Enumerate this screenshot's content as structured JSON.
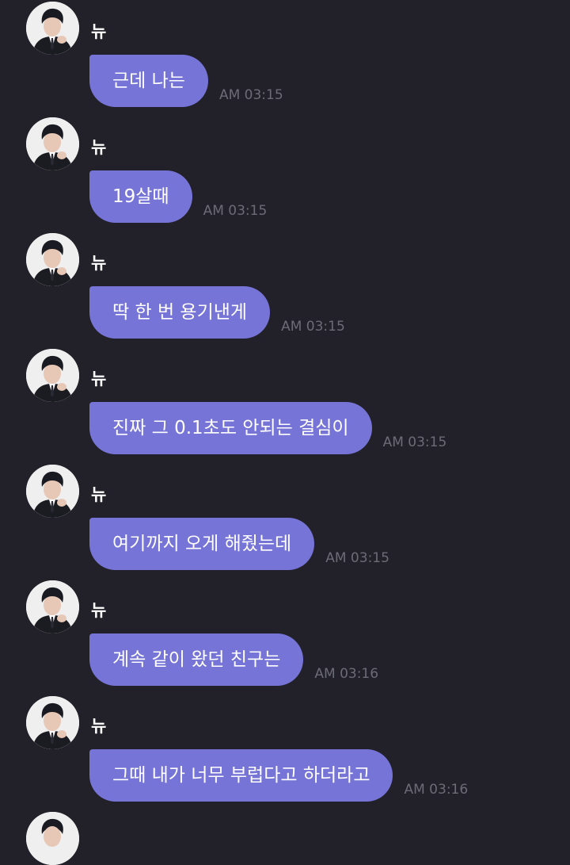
{
  "messages": [
    {
      "sender": "뉴",
      "text": "근데 나는",
      "time": "AM 03:15"
    },
    {
      "sender": "뉴",
      "text": "19살때",
      "time": "AM 03:15"
    },
    {
      "sender": "뉴",
      "text": "딱 한 번 용기낸게",
      "time": "AM 03:15"
    },
    {
      "sender": "뉴",
      "text": "진짜 그 0.1초도 안되는 결심이",
      "time": "AM 03:15"
    },
    {
      "sender": "뉴",
      "text": "여기까지 오게 해줬는데",
      "time": "AM 03:15"
    },
    {
      "sender": "뉴",
      "text": "계속 같이 왔던 친구는",
      "time": "AM 03:16"
    },
    {
      "sender": "뉴",
      "text": "그때 내가 너무 부럽다고 하더라고",
      "time": "AM 03:16"
    }
  ],
  "colors": {
    "background": "#222129",
    "bubble": "#7674d6",
    "timestamp": "#6c6b76",
    "text": "#ffffff"
  },
  "icons": {
    "avatar": "profile-photo-avatar"
  }
}
